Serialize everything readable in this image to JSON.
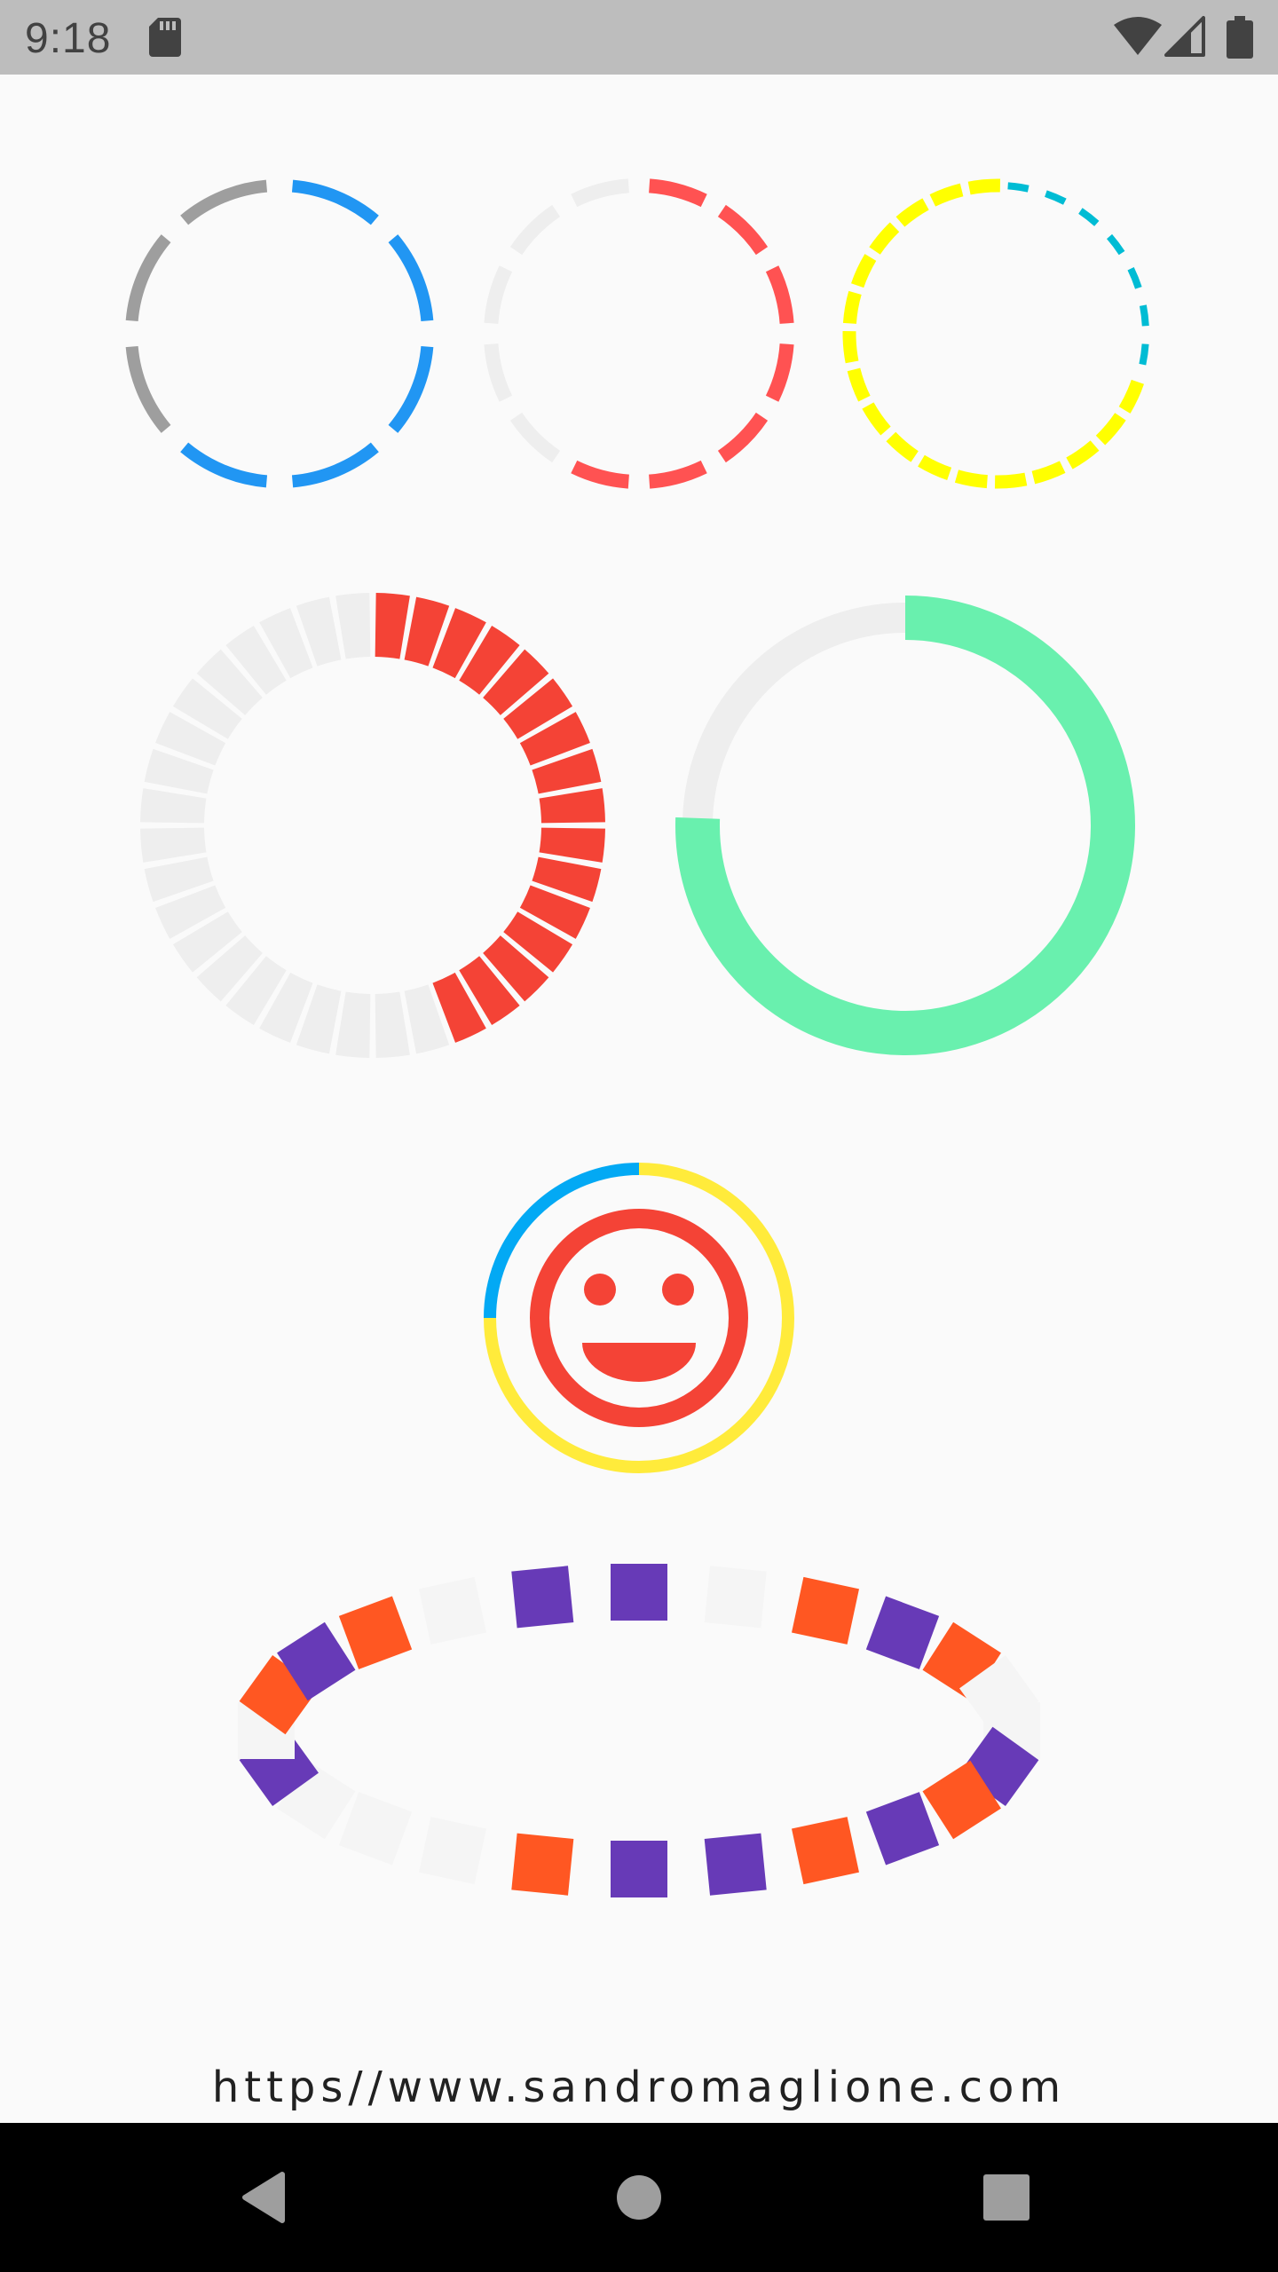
{
  "status_bar": {
    "time": "9:18",
    "icons": [
      "sd-card-icon",
      "wifi-icon",
      "cell-signal-icon",
      "battery-icon"
    ],
    "icon_color": "#424242",
    "background": "#BDBDBD"
  },
  "colors": {
    "background": "#FAFAFA",
    "blue": "#2196F3",
    "grey": "#9E9E9E",
    "light_grey": "#EEEEEE",
    "coral": "#FF5252",
    "yellow": "#FFFF00",
    "cyan": "#00BCD4",
    "red": "#F44336",
    "mint": "#69F0AE",
    "light_blue": "#03A9F4",
    "amber_yellow": "#FFEB3B",
    "deep_purple": "#673AB7",
    "deep_orange": "#FF5722",
    "ghost_grey": "#F5F5F5"
  },
  "indicators": {
    "dashed_blue_grey": {
      "segments": 8,
      "progress_segments": 5
    },
    "dashed_coral": {
      "segments": 12,
      "progress_segments": 7
    },
    "dotted_yellow_cyan": {
      "segments": 24,
      "progress_segments": 7
    },
    "blocks_red": {
      "segments": 36,
      "progress_segments": 16
    },
    "solid_mint": {
      "progress": 0.75
    },
    "smiley_ring": {
      "progress": 0.25
    },
    "ellipse_squares": {
      "segments": 24
    }
  },
  "footer": {
    "url": "https//www.sandromaglione.com"
  },
  "nav_bar": {
    "buttons": [
      "back-icon",
      "home-icon",
      "recents-icon"
    ],
    "color": "#9E9E9E"
  }
}
